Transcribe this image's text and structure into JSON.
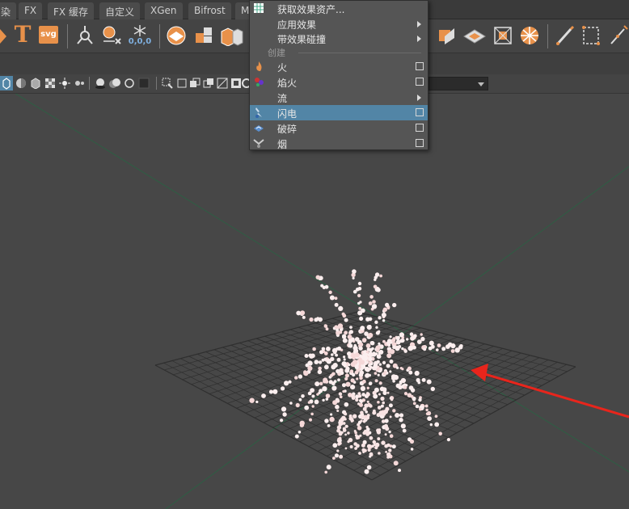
{
  "shelf_tabs": [
    "染",
    "FX",
    "FX 缓存",
    "自定义",
    "XGen",
    "Bifrost",
    "M"
  ],
  "shelf_icons": {
    "text_icon": "T",
    "svg_icon": "svg",
    "coord_label": "0,0,0"
  },
  "fx_menu": {
    "items": [
      {
        "label": "获取效果资产...",
        "type": "action"
      },
      {
        "label": "应用效果",
        "type": "submenu"
      },
      {
        "label": "带效果碰撞",
        "type": "submenu"
      }
    ],
    "section_label": "创建",
    "create_items": [
      {
        "label": "火",
        "type": "option",
        "icon": "fire-icon"
      },
      {
        "label": "焰火",
        "type": "option",
        "icon": "fireworks-icon"
      },
      {
        "label": "流",
        "type": "submenu",
        "icon": ""
      },
      {
        "label": "闪电",
        "type": "option",
        "icon": "lightning-icon",
        "highlighted": true
      },
      {
        "label": "破碎",
        "type": "option",
        "icon": "shatter-icon"
      },
      {
        "label": "烟",
        "type": "option",
        "icon": "smoke-icon"
      }
    ]
  },
  "colors": {
    "menu_highlight": "#5285a6",
    "shelf_accent": "#e8914a",
    "annotation_arrow": "#e8251c",
    "grid_line": "#2f2f2f",
    "axis_line": "#2e5e44"
  }
}
